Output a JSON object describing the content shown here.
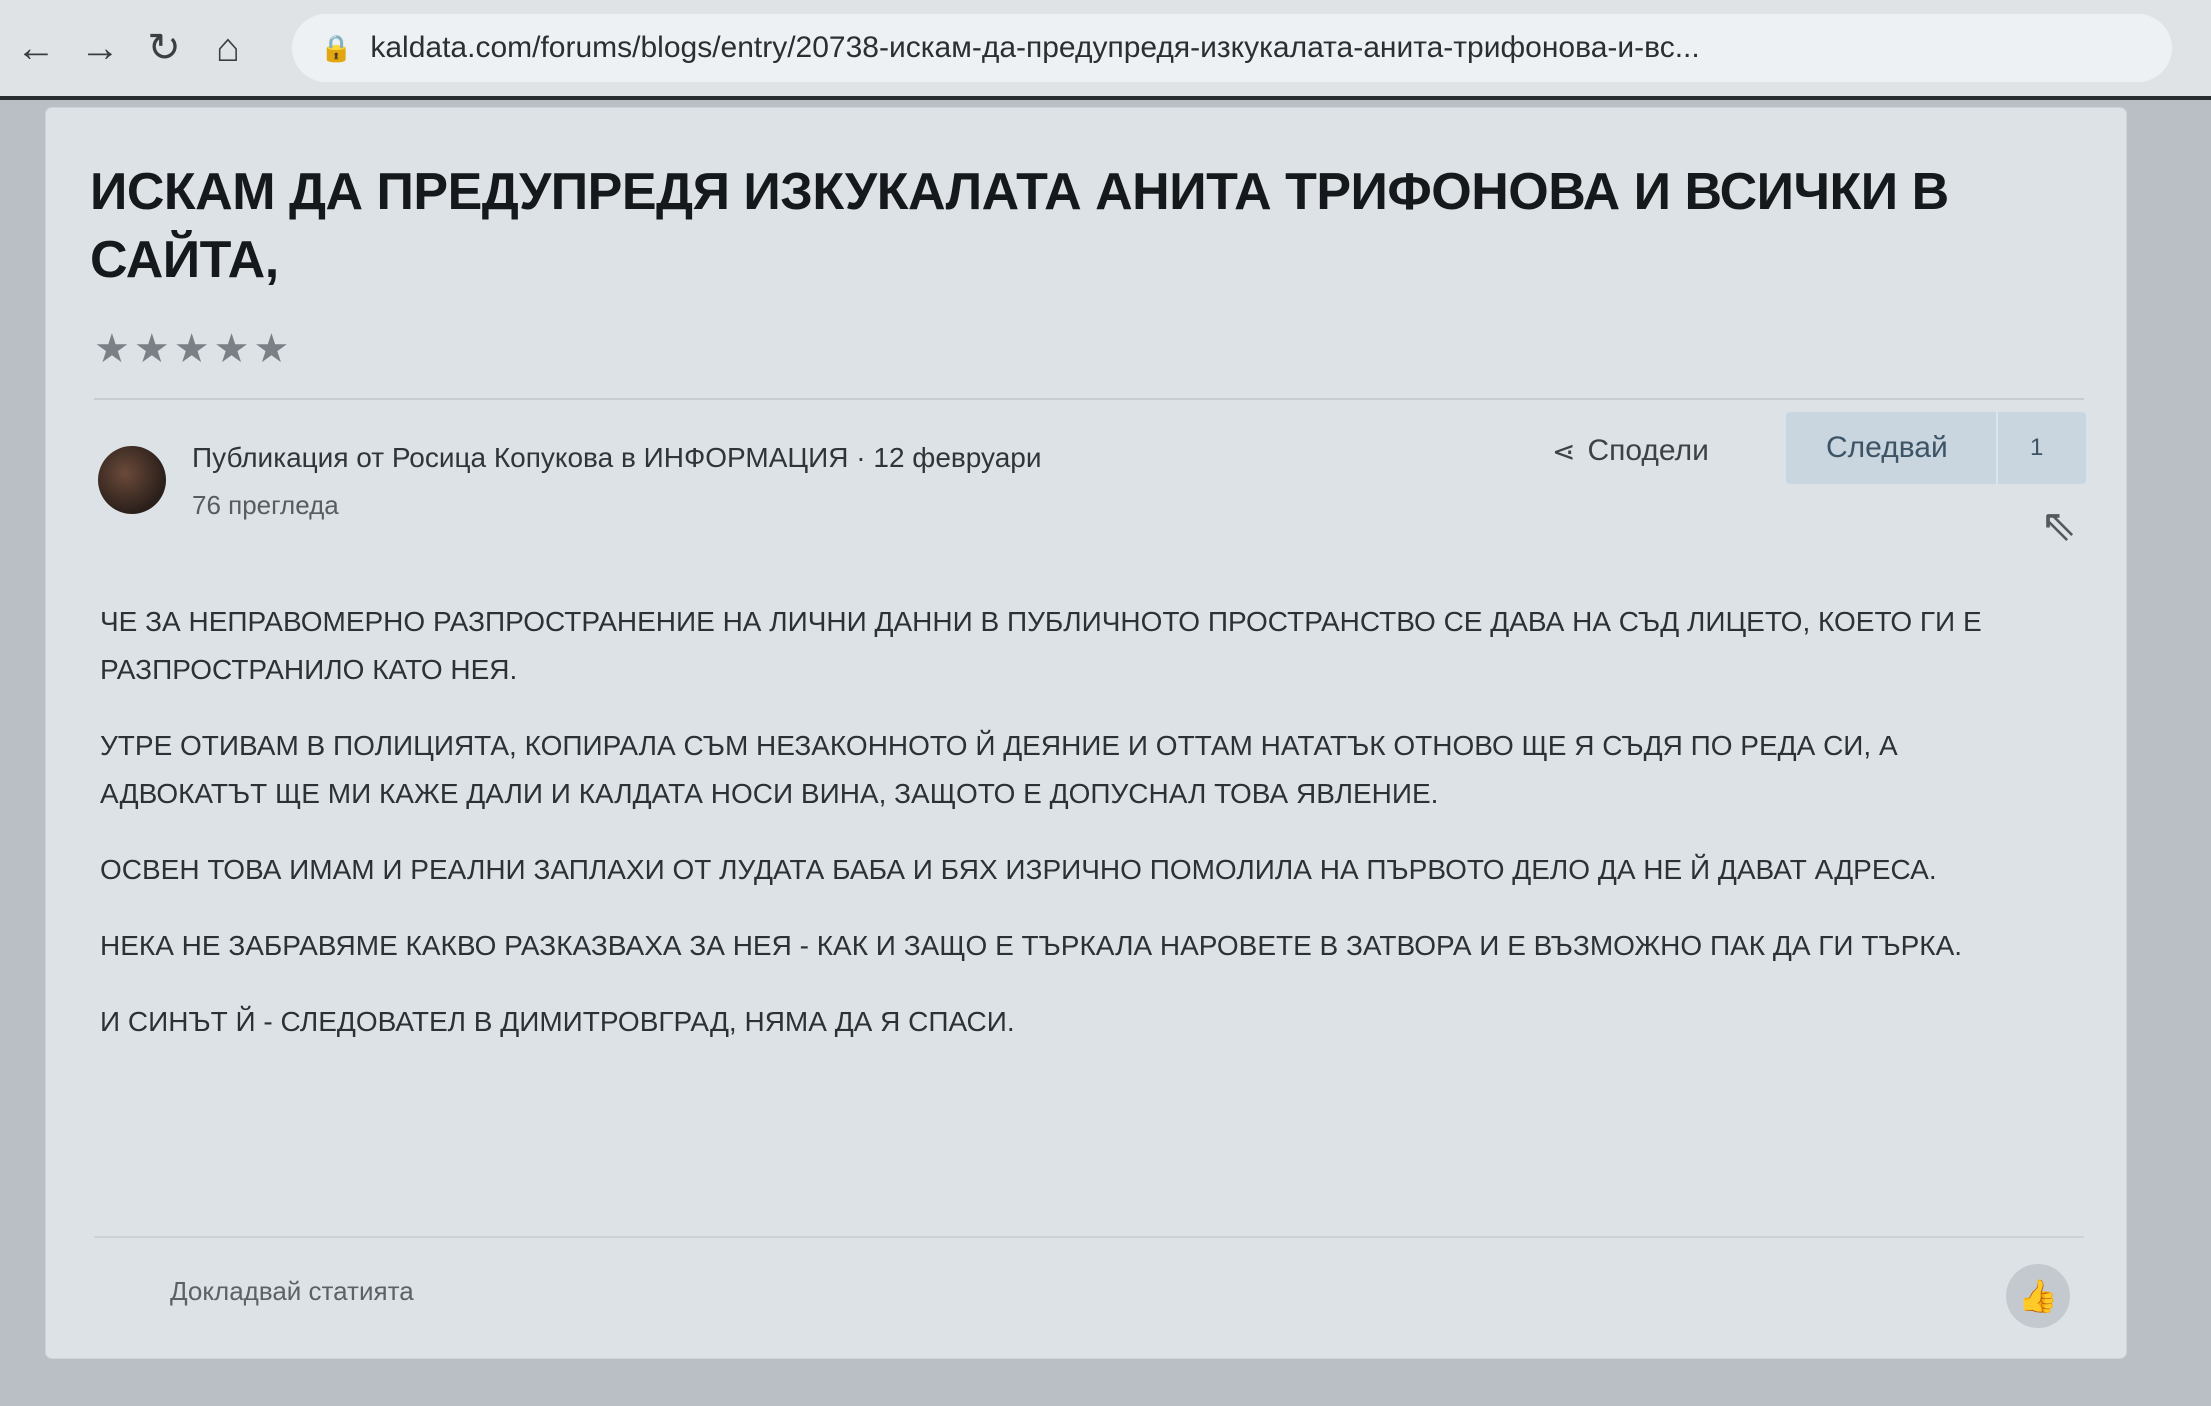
{
  "browser": {
    "url": "kaldata.com/forums/blogs/entry/20738-искам-да-предупредя-изкукалата-анита-трифонова-и-вс..."
  },
  "article": {
    "title": "ИСКАМ ДА ПРЕДУПРЕДЯ ИЗКУКАЛАТА АНИТА ТРИФОНОВА И ВСИЧКИ В САЙТА,",
    "rating_stars": 5,
    "byline_prefix": "Публикация от",
    "author": "Росица Копукова",
    "in_word": "в",
    "category": "ИНФОРМАЦИЯ",
    "date": "· 12 февруари",
    "views": "76 прегледа",
    "share_label": "Сподели",
    "follow_label": "Следвай",
    "follow_count": "1",
    "paragraphs": [
      "Че за неправомерно разпространение на лични данни в публичното пространство се дава на съд лицето, което ги е разпространило като нея.",
      "Утре отивам в полицията, копирала съм незаконното й деяние и оттам нататък отново ще я съдя по реда си, а адвокатът ще ми каже дали и Калдата носи вина, защото е допуснал това явление.",
      "Освен това имам и реални заплахи от лудата баба и бях изрично помолила на първото дело да не й дават адреса.",
      "Нека не забравяме какво разказваха за нея - как и защо е търкала наровете в затвора и е възможно пак да ги търка.",
      "И синът й - следовател в Димитровград, няма да я спаси."
    ],
    "report_label": "Докладвай статията"
  },
  "icons": {
    "back": "back-arrow-icon",
    "forward": "forward-arrow-icon",
    "reload": "reload-icon",
    "home": "home-icon",
    "lock": "lock-icon",
    "share": "share-icon",
    "like": "thumbs-up-icon"
  }
}
